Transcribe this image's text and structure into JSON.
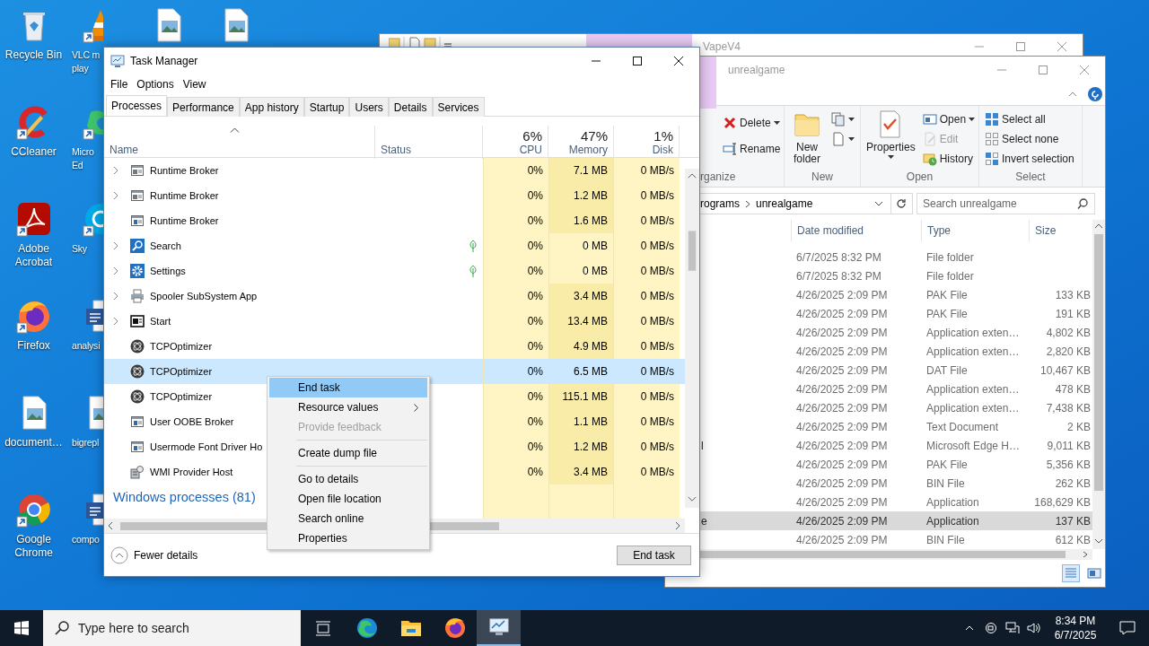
{
  "desktop": {
    "icons": [
      {
        "label": "Recycle Bin",
        "kind": "recycle",
        "shortcut": false
      },
      {
        "label": "CCleaner",
        "kind": "ccleaner",
        "shortcut": true
      },
      {
        "label": "Adobe Acrobat",
        "kind": "acrobat",
        "shortcut": true
      },
      {
        "label": "Firefox",
        "kind": "firefox",
        "shortcut": true
      },
      {
        "label": "document…",
        "kind": "image-file",
        "shortcut": false
      },
      {
        "label": "Google Chrome",
        "kind": "chrome",
        "shortcut": true
      },
      {
        "label": "VLC m\nplay",
        "kind": "vlc",
        "shortcut": true
      },
      {
        "label": "Micro\nEd",
        "kind": "edge",
        "shortcut": true
      },
      {
        "label": "Sky",
        "kind": "skype",
        "shortcut": true
      },
      {
        "label": "analysi",
        "kind": "word",
        "shortcut": false
      },
      {
        "label": "bigrepl",
        "kind": "image-file",
        "shortcut": false
      },
      {
        "label": "compo",
        "kind": "word",
        "shortcut": false
      },
      {
        "kind": "image-file",
        "shortcut": false
      },
      {
        "kind": "image-file",
        "shortcut": false
      }
    ]
  },
  "back_window": {
    "title": "VapeV4"
  },
  "explorer": {
    "title": "unrealgame",
    "ribbon": {
      "groups": [
        {
          "label": "rganize",
          "columns": [
            [
              {
                "kind": "delete",
                "label": "Delete",
                "dropdown": true,
                "disabled": false
              },
              {
                "kind": "rename",
                "label": "Rename",
                "dropdown": false,
                "disabled": false
              }
            ]
          ]
        },
        {
          "label": "New",
          "columns": [
            [
              {
                "kind": "new-folder",
                "label": "New folder",
                "dropdown": false,
                "disabled": false
              }
            ],
            [
              {
                "kind": "copy",
                "dropdown": true,
                "disabled": false
              },
              {
                "kind": "page",
                "dropdown": true,
                "disabled": false
              }
            ]
          ]
        },
        {
          "label": "Open",
          "columns": [
            [
              {
                "kind": "properties",
                "label": "Properties",
                "dropdown": true,
                "disabled": false
              }
            ],
            [
              {
                "kind": "open",
                "label": "Open",
                "dropdown": true,
                "disabled": false
              },
              {
                "kind": "edit",
                "label": "Edit",
                "dropdown": false,
                "disabled": true
              },
              {
                "kind": "history",
                "label": "History",
                "dropdown": false,
                "disabled": false
              }
            ]
          ]
        },
        {
          "label": "Select",
          "columns": [
            [
              {
                "kind": "select-all",
                "label": "Select all",
                "dropdown": false,
                "disabled": false
              },
              {
                "kind": "select-none",
                "label": "Select none",
                "dropdown": false,
                "disabled": false
              },
              {
                "kind": "invert",
                "label": "Invert selection",
                "dropdown": false,
                "disabled": false
              }
            ]
          ]
        }
      ]
    },
    "address": {
      "segments": [
        "rograms",
        "unrealgame"
      ]
    },
    "search": {
      "placeholder": "Search unrealgame"
    },
    "columns": [
      "Date modified",
      "Type",
      "Size"
    ],
    "rows": [
      {
        "date": "6/7/2025 8:32 PM",
        "type": "File folder",
        "selected": false
      },
      {
        "date": "6/7/2025 8:32 PM",
        "type": "File folder",
        "selected": false
      },
      {
        "date": "4/26/2025 2:09 PM",
        "type": "PAK File",
        "size": "133 KB",
        "selected": false
      },
      {
        "date": "4/26/2025 2:09 PM",
        "type": "PAK File",
        "size": "191 KB",
        "selected": false
      },
      {
        "date": "4/26/2025 2:09 PM",
        "type": "Application exten…",
        "size": "4,802 KB",
        "selected": false
      },
      {
        "date": "4/26/2025 2:09 PM",
        "type": "Application exten…",
        "size": "2,820 KB",
        "selected": false
      },
      {
        "date": "4/26/2025 2:09 PM",
        "type": "DAT File",
        "size": "10,467 KB",
        "selected": false
      },
      {
        "date": "4/26/2025 2:09 PM",
        "type": "Application exten…",
        "size": "478 KB",
        "selected": false
      },
      {
        "date": "4/26/2025 2:09 PM",
        "type": "Application exten…",
        "size": "7,438 KB",
        "selected": false
      },
      {
        "date": "4/26/2025 2:09 PM",
        "type": "Text Document",
        "size": "2 KB",
        "selected": false
      },
      {
        "name": "l",
        "date": "4/26/2025 2:09 PM",
        "type": "Microsoft Edge H…",
        "size": "9,011 KB",
        "selected": false
      },
      {
        "date": "4/26/2025 2:09 PM",
        "type": "PAK File",
        "size": "5,356 KB",
        "selected": false
      },
      {
        "date": "4/26/2025 2:09 PM",
        "type": "BIN File",
        "size": "262 KB",
        "selected": false
      },
      {
        "date": "4/26/2025 2:09 PM",
        "type": "Application",
        "size": "168,629 KB",
        "selected": false
      },
      {
        "name": "e",
        "date": "4/26/2025 2:09 PM",
        "type": "Application",
        "size": "137 KB",
        "selected": true
      },
      {
        "date": "4/26/2025 2:09 PM",
        "type": "BIN File",
        "size": "612 KB",
        "selected": false
      }
    ],
    "views": [
      {
        "kind": "details",
        "selected": true
      },
      {
        "kind": "tiles",
        "selected": false
      }
    ]
  },
  "task_manager": {
    "title": "Task Manager",
    "menu": [
      "File",
      "Options",
      "View"
    ],
    "tabs": [
      {
        "label": "Processes",
        "selected": true
      },
      {
        "label": "Performance",
        "selected": false
      },
      {
        "label": "App history",
        "selected": false
      },
      {
        "label": "Startup",
        "selected": false
      },
      {
        "label": "Users",
        "selected": false
      },
      {
        "label": "Details",
        "selected": false
      },
      {
        "label": "Services",
        "selected": false
      }
    ],
    "columns": [
      {
        "label": "Name",
        "kind": "name",
        "sorted": true
      },
      {
        "label": "Status",
        "kind": "text",
        "sorted": false
      },
      {
        "label": "CPU",
        "kind": "metric",
        "usage": "6%",
        "sorted": false
      },
      {
        "label": "Memory",
        "kind": "metric",
        "usage": "47%",
        "sorted": false
      },
      {
        "label": "Disk",
        "kind": "metric",
        "usage": "1%",
        "sorted": false
      }
    ],
    "processes": [
      {
        "name": "Runtime Broker",
        "kind": "window",
        "expandable": true,
        "leaf": false,
        "cpu": "0%",
        "memory": "7.1 MB",
        "memory_highlighted": true,
        "disk": "0 MB/s",
        "selected": false
      },
      {
        "name": "Runtime Broker",
        "kind": "window",
        "expandable": true,
        "leaf": false,
        "cpu": "0%",
        "memory": "1.2 MB",
        "memory_highlighted": true,
        "disk": "0 MB/s",
        "selected": false
      },
      {
        "name": "Runtime Broker",
        "kind": "app-window",
        "expandable": false,
        "leaf": false,
        "cpu": "0%",
        "memory": "1.6 MB",
        "memory_highlighted": true,
        "disk": "0 MB/s",
        "selected": false
      },
      {
        "name": "Search",
        "kind": "search",
        "expandable": true,
        "leaf": true,
        "cpu": "0%",
        "memory": "0 MB",
        "memory_highlighted": false,
        "disk": "0 MB/s",
        "selected": false
      },
      {
        "name": "Settings",
        "kind": "gear",
        "expandable": true,
        "leaf": true,
        "cpu": "0%",
        "memory": "0 MB",
        "memory_highlighted": false,
        "disk": "0 MB/s",
        "selected": false
      },
      {
        "name": "Spooler SubSystem App",
        "kind": "printer",
        "expandable": true,
        "leaf": false,
        "cpu": "0%",
        "memory": "3.4 MB",
        "memory_highlighted": true,
        "disk": "0 MB/s",
        "selected": false
      },
      {
        "name": "Start",
        "kind": "start",
        "expandable": true,
        "leaf": false,
        "cpu": "0%",
        "memory": "13.4 MB",
        "memory_highlighted": true,
        "disk": "0 MB/s",
        "selected": false
      },
      {
        "name": "TCPOptimizer",
        "kind": "tcp",
        "expandable": false,
        "leaf": false,
        "cpu": "0%",
        "memory": "4.9 MB",
        "memory_highlighted": true,
        "disk": "0 MB/s",
        "selected": false
      },
      {
        "name": "TCPOptimizer",
        "kind": "tcp",
        "expandable": false,
        "leaf": false,
        "cpu": "0%",
        "memory": "6.5 MB",
        "memory_highlighted": true,
        "disk": "0 MB/s",
        "selected": true
      },
      {
        "name": "TCPOptimizer",
        "kind": "tcp",
        "expandable": false,
        "leaf": false,
        "cpu": "0%",
        "memory": "115.1 MB",
        "memory_highlighted": true,
        "disk": "0 MB/s",
        "selected": false
      },
      {
        "name": "User OOBE Broker",
        "kind": "app-window",
        "expandable": false,
        "leaf": false,
        "cpu": "0%",
        "memory": "1.1 MB",
        "memory_highlighted": true,
        "disk": "0 MB/s",
        "selected": false
      },
      {
        "name": "Usermode Font Driver Ho",
        "kind": "app-window",
        "expandable": false,
        "leaf": false,
        "cpu": "0%",
        "memory": "1.2 MB",
        "memory_highlighted": true,
        "disk": "0 MB/s",
        "selected": false
      },
      {
        "name": "WMI Provider Host",
        "kind": "wmi",
        "expandable": false,
        "leaf": false,
        "cpu": "0%",
        "memory": "3.4 MB",
        "memory_highlighted": true,
        "disk": "0 MB/s",
        "selected": false
      }
    ],
    "group": "Windows processes (81)",
    "footer": {
      "details_link": "Fewer details",
      "button": "End task"
    },
    "context_menu": {
      "items": [
        {
          "kind": "item",
          "label": "End task",
          "selected": true,
          "disabled": false,
          "submenu": false
        },
        {
          "kind": "item",
          "label": "Resource values",
          "selected": false,
          "disabled": false,
          "submenu": true
        },
        {
          "kind": "item",
          "label": "Provide feedback",
          "selected": false,
          "disabled": true,
          "submenu": false
        },
        {
          "kind": "separator"
        },
        {
          "kind": "item",
          "label": "Create dump file",
          "selected": false,
          "disabled": false,
          "submenu": false
        },
        {
          "kind": "separator"
        },
        {
          "kind": "item",
          "label": "Go to details",
          "selected": false,
          "disabled": false,
          "submenu": false
        },
        {
          "kind": "item",
          "label": "Open file location",
          "selected": false,
          "disabled": false,
          "submenu": false
        },
        {
          "kind": "item",
          "label": "Search online",
          "selected": false,
          "disabled": false,
          "submenu": false
        },
        {
          "kind": "item",
          "label": "Properties",
          "selected": false,
          "disabled": false,
          "submenu": false
        }
      ]
    }
  },
  "taskbar": {
    "search_placeholder": "Type here to search",
    "apps": [
      {
        "kind": "task-view",
        "active": false
      },
      {
        "kind": "edge",
        "active": false
      },
      {
        "kind": "explorer",
        "active": false
      },
      {
        "kind": "firefox",
        "active": false
      },
      {
        "kind": "task-manager",
        "active": true
      }
    ],
    "clock": {
      "time": "8:34 PM",
      "date": "6/7/2025"
    }
  }
}
